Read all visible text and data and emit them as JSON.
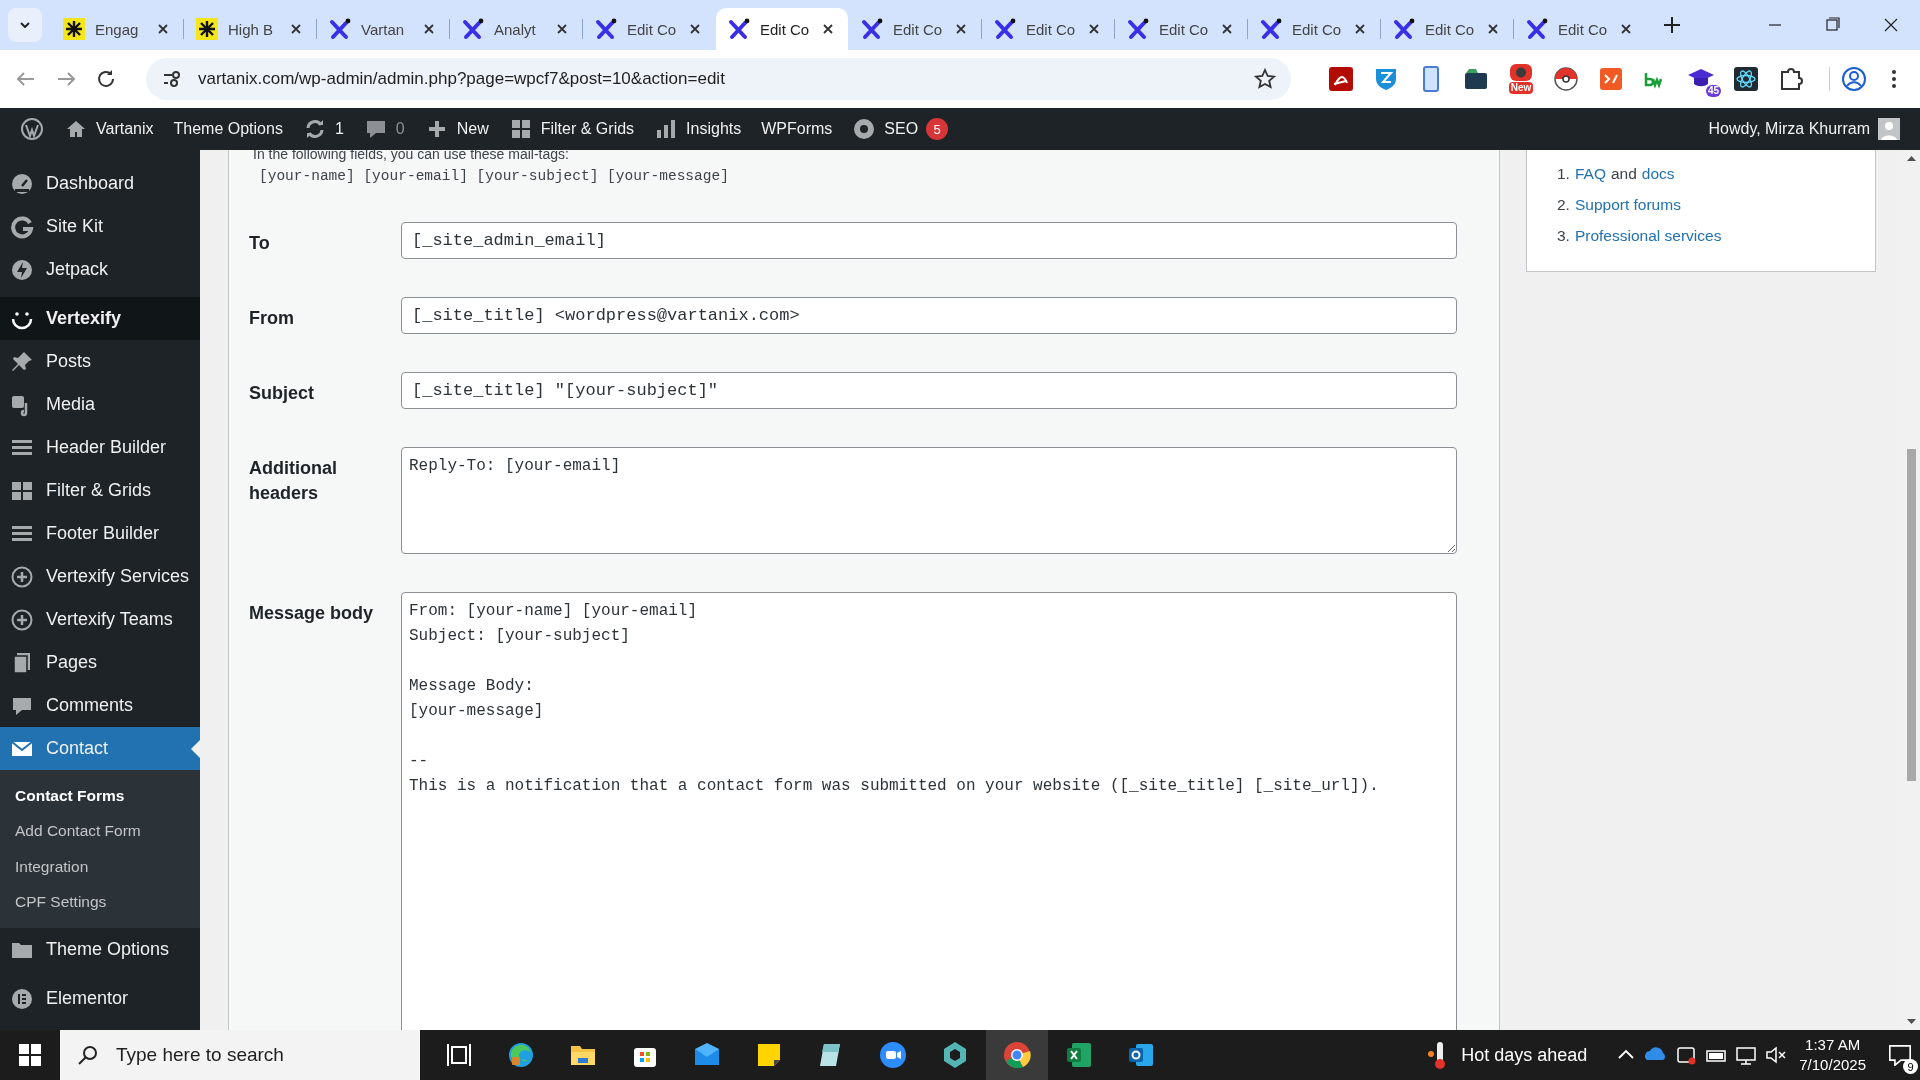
{
  "browser": {
    "tabs": [
      {
        "title": "Engag",
        "kind": "star",
        "selected": false
      },
      {
        "title": "High B",
        "kind": "star",
        "selected": false
      },
      {
        "title": "Vartan",
        "kind": "x",
        "selected": false
      },
      {
        "title": "Analyt",
        "kind": "x",
        "selected": false
      },
      {
        "title": "Edit Co",
        "kind": "x",
        "selected": false
      },
      {
        "title": "Edit Co",
        "kind": "x",
        "selected": true
      },
      {
        "title": "Edit Co",
        "kind": "x",
        "selected": false
      },
      {
        "title": "Edit Co",
        "kind": "x",
        "selected": false
      },
      {
        "title": "Edit Co",
        "kind": "x",
        "selected": false
      },
      {
        "title": "Edit Co",
        "kind": "x",
        "selected": false
      },
      {
        "title": "Edit Co",
        "kind": "x",
        "selected": false
      },
      {
        "title": "Edit Co",
        "kind": "x",
        "selected": false
      }
    ],
    "address": "vartanix.com/wp-admin/admin.php?page=wpcf7&post=10&action=edit",
    "extensions": [
      {
        "kind": "pdf"
      },
      {
        "kind": "shield"
      },
      {
        "kind": "phone"
      },
      {
        "kind": "folder"
      },
      {
        "kind": "camera",
        "badge": "New"
      },
      {
        "kind": "ball"
      },
      {
        "kind": "code"
      },
      {
        "kind": "bw"
      },
      {
        "kind": "cap",
        "badge": "45"
      },
      {
        "kind": "atom"
      },
      {
        "kind": "puzzle"
      }
    ]
  },
  "admin_bar": {
    "items": [
      {
        "kind": "logo"
      },
      {
        "kind": "home",
        "label": "Vartanix"
      },
      {
        "kind": "text",
        "label": "Theme Options"
      },
      {
        "kind": "updates",
        "label": "1"
      },
      {
        "kind": "comments",
        "label": "0"
      },
      {
        "kind": "new",
        "label": "New"
      },
      {
        "kind": "grid",
        "label": "Filter & Grids"
      },
      {
        "kind": "chart",
        "label": "Insights"
      },
      {
        "kind": "text",
        "label": "WPForms"
      },
      {
        "kind": "seo",
        "label": "SEO",
        "badge": "5"
      }
    ],
    "greeting": "Howdy, Mirza Khurram"
  },
  "sidebar": {
    "items": [
      {
        "label": "Dashboard",
        "kind": "gauge",
        "selected": false,
        "hovered": false
      },
      {
        "label": "Site Kit",
        "kind": "g",
        "selected": false,
        "hovered": false
      },
      {
        "label": "Jetpack",
        "kind": "bolt",
        "selected": false,
        "hovered": false
      },
      {
        "label": "Vertexify",
        "kind": "smile",
        "selected": false,
        "hovered": true
      },
      {
        "label": "Posts",
        "kind": "pin",
        "selected": false,
        "hovered": false
      },
      {
        "label": "Media",
        "kind": "media",
        "selected": false,
        "hovered": false
      },
      {
        "label": "Header Builder",
        "kind": "lines",
        "selected": false,
        "hovered": false
      },
      {
        "label": "Filter & Grids",
        "kind": "table",
        "selected": false,
        "hovered": false
      },
      {
        "label": "Footer Builder",
        "kind": "lines",
        "selected": false,
        "hovered": false
      },
      {
        "label": "Vertexify Services",
        "kind": "plus",
        "selected": false,
        "hovered": false
      },
      {
        "label": "Vertexify Teams",
        "kind": "plus",
        "selected": false,
        "hovered": false
      },
      {
        "label": "Pages",
        "kind": "page",
        "selected": false,
        "hovered": false
      },
      {
        "label": "Comments",
        "kind": "bubble",
        "selected": false,
        "hovered": false
      },
      {
        "label": "Contact",
        "kind": "mail",
        "selected": true,
        "hovered": false,
        "children": [
          {
            "label": "Contact Forms",
            "selected": true
          },
          {
            "label": "Add Contact Form",
            "selected": false
          },
          {
            "label": "Integration",
            "selected": false
          },
          {
            "label": "CPF Settings",
            "selected": false
          }
        ]
      },
      {
        "label": "Theme Options",
        "kind": "folder",
        "selected": false,
        "hovered": false
      },
      {
        "label": "Elementor",
        "kind": "elementor",
        "selected": false,
        "hovered": false
      }
    ]
  },
  "mail_form": {
    "intro": "In the following fields, you can use these mail-tags:",
    "mail_tags": "[your-name] [your-email] [your-subject] [your-message]",
    "fields": [
      {
        "label": "To",
        "kind": "input",
        "value": "[_site_admin_email]"
      },
      {
        "label": "From",
        "kind": "input",
        "value": "[_site_title] <wordpress@vartanix.com>"
      },
      {
        "label": "Subject",
        "kind": "input",
        "value": "[_site_title] \"[your-subject]\""
      },
      {
        "label": "Additional headers",
        "kind": "textarea",
        "value": "Reply-To: [your-email]"
      },
      {
        "label": "Message body",
        "kind": "body",
        "value": "From: [your-name] [your-email]\nSubject: [your-subject]\n\nMessage Body:\n[your-message]\n\n--\nThis is a notification that a contact form was submitted on your website ([_site_title] [_site_url])."
      }
    ]
  },
  "help_box": {
    "items": [
      {
        "number": "1.",
        "parts": [
          {
            "text": "FAQ",
            "link": true
          },
          {
            "text": "and",
            "link": false
          },
          {
            "text": "docs",
            "link": true
          }
        ]
      },
      {
        "number": "2.",
        "parts": [
          {
            "text": "Support forums",
            "link": true
          }
        ]
      },
      {
        "number": "3.",
        "parts": [
          {
            "text": "Professional services",
            "link": true
          }
        ]
      }
    ]
  },
  "taskbar": {
    "search_placeholder": "Type here to search",
    "apps": [
      {
        "kind": "taskview",
        "active": false
      },
      {
        "kind": "edge",
        "active": false
      },
      {
        "kind": "explorer",
        "active": false
      },
      {
        "kind": "store",
        "active": false
      },
      {
        "kind": "mail",
        "active": false
      },
      {
        "kind": "sticky",
        "active": false
      },
      {
        "kind": "notepad",
        "active": false
      },
      {
        "kind": "zoom",
        "active": false
      },
      {
        "kind": "gem",
        "active": false
      },
      {
        "kind": "chrome",
        "active": true
      },
      {
        "kind": "excel",
        "active": false
      },
      {
        "kind": "outlook",
        "active": false
      }
    ],
    "weather": "Hot days ahead",
    "time": "1:37 AM",
    "date": "7/10/2025",
    "notifications": "9"
  }
}
